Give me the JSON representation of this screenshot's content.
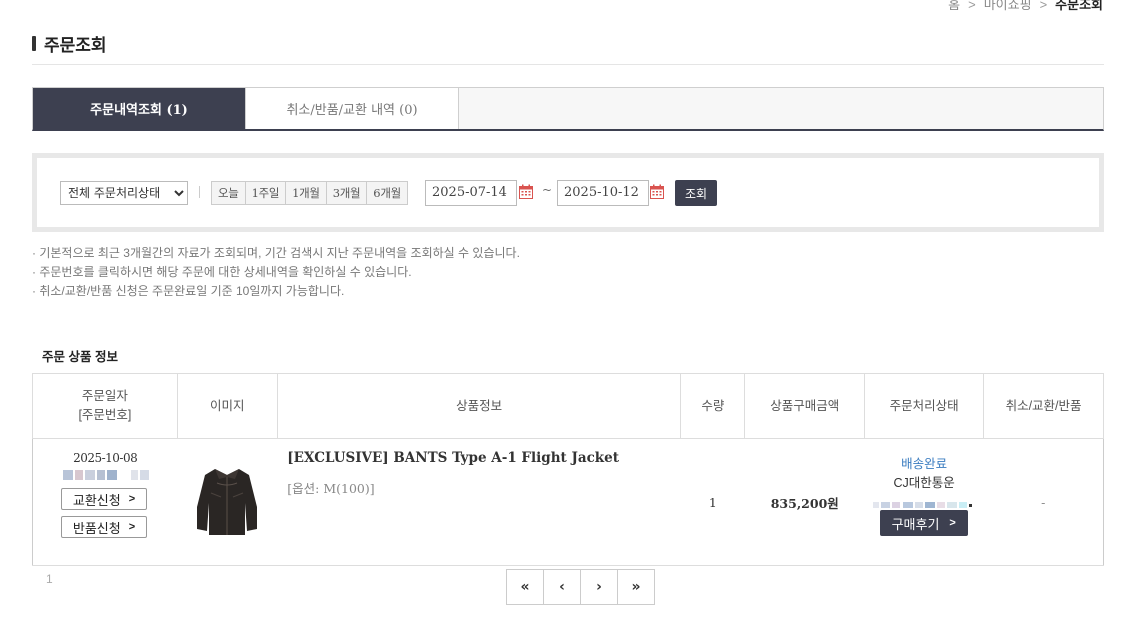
{
  "breadcrumb": {
    "home": "홈",
    "mypage": "마이쇼핑",
    "current": "주문조회"
  },
  "page_title": "주문조회",
  "tabs": [
    {
      "label": "주문내역조회 (1)",
      "active": true
    },
    {
      "label": "취소/반품/교환 내역 (0)",
      "active": false
    }
  ],
  "search": {
    "status_selected": "전체 주문처리상태",
    "periods": [
      "오늘",
      "1주일",
      "1개월",
      "3개월",
      "6개월"
    ],
    "date_from": "2025-07-14",
    "date_to": "2025-10-12",
    "tilde": "~",
    "button": "조회"
  },
  "notes": [
    "기본적으로 최근 3개월간의 자료가 조회되며, 기간 검색시 지난 주문내역을 조회하실 수 있습니다.",
    "주문번호를 클릭하시면 해당 주문에 대한 상세내역을 확인하실 수 있습니다.",
    "취소/교환/반품 신청은 주문완료일 기준 10일까지 가능합니다."
  ],
  "section_title": "주문 상품 정보",
  "table": {
    "headers": {
      "date_line1": "주문일자",
      "date_line2": "[주문번호]",
      "image": "이미지",
      "info": "상품정보",
      "qty": "수량",
      "price": "상품구매금액",
      "status": "주문처리상태",
      "cancel": "취소/교환/반품"
    },
    "rows": [
      {
        "date": "2025-10-08",
        "exchange_btn": "교환신청",
        "return_btn": "반품신청",
        "product_name": "[EXCLUSIVE] BANTS Type A-1 Flight Jacket",
        "option": "[옵션: M(100)]",
        "qty": "1",
        "price": "835,200원",
        "status": "배송완료",
        "carrier": "CJ대한통운",
        "review_btn": "구매후기",
        "cancel": "-"
      }
    ]
  },
  "pagination": {
    "current_page": "1",
    "first": "«",
    "prev": "‹",
    "next": "›",
    "last": "»"
  },
  "colors": {
    "accent": "#3d4050",
    "link": "#3a7cc0"
  }
}
